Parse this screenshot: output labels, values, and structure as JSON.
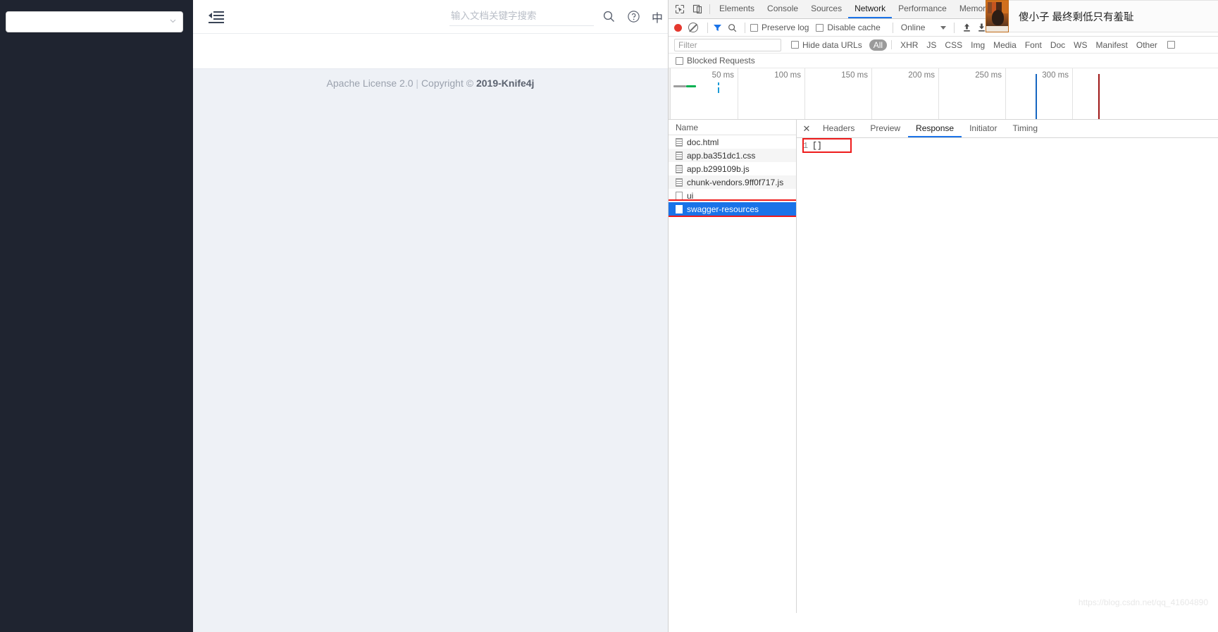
{
  "webpage": {
    "sidebar": {
      "select_value": "",
      "select_icon": "chevron-down-icon"
    },
    "header": {
      "menu_toggle_icon": "collapse-menu-icon",
      "search_placeholder": "输入文档关键字搜索",
      "search_value": "",
      "search_icon": "search-icon",
      "help_icon": "help-circle-icon",
      "language_label": "中"
    },
    "footer": {
      "license": "Apache License 2.0",
      "separator": "|",
      "copyright_prefix": "Copyright",
      "copyright_symbol": "©",
      "copyright_year_brand": "2019-Knife4j"
    }
  },
  "devtools": {
    "tool_icons": [
      {
        "name": "inspect-element-icon"
      },
      {
        "name": "device-toolbar-icon"
      }
    ],
    "panels": [
      {
        "label": "Elements",
        "active": false
      },
      {
        "label": "Console",
        "active": false
      },
      {
        "label": "Sources",
        "active": false
      },
      {
        "label": "Network",
        "active": true
      },
      {
        "label": "Performance",
        "active": false
      },
      {
        "label": "Memory",
        "active": false
      }
    ],
    "toast": {
      "text": "傻小子 最终剩低只有羞耻",
      "thumbnail_name": "video-thumbnail"
    },
    "toolbar": {
      "record_icon": "record-button-icon",
      "clear_icon": "clear-icon",
      "filter_icon": "filter-funnel-icon",
      "search_icon": "search-icon",
      "preserve_log_label": "Preserve log",
      "preserve_log_checked": false,
      "disable_cache_label": "Disable cache",
      "disable_cache_checked": false,
      "throttle_value": "Online",
      "throttle_caret_icon": "chevron-down-icon",
      "import_icon": "import-har-icon",
      "export_icon": "export-har-icon"
    },
    "filterbar": {
      "filter_placeholder": "Filter",
      "filter_value": "",
      "hide_data_urls_label": "Hide data URLs",
      "hide_data_urls_checked": false,
      "types": [
        {
          "label": "All",
          "active": true
        },
        {
          "label": "XHR",
          "active": false
        },
        {
          "label": "JS",
          "active": false
        },
        {
          "label": "CSS",
          "active": false
        },
        {
          "label": "Img",
          "active": false
        },
        {
          "label": "Media",
          "active": false
        },
        {
          "label": "Font",
          "active": false
        },
        {
          "label": "Doc",
          "active": false
        },
        {
          "label": "WS",
          "active": false
        },
        {
          "label": "Manifest",
          "active": false
        },
        {
          "label": "Other",
          "active": false
        }
      ],
      "trailing_checkbox_checked": false
    },
    "blocked_requests": {
      "label": "Blocked Requests",
      "checked": false
    },
    "overview": {
      "ticks": [
        "50 ms",
        "100 ms",
        "150 ms",
        "200 ms",
        "250 ms",
        "300 ms"
      ],
      "dom_content_loaded_color": "#1565c0",
      "load_event_color": "#9e1616",
      "waiting_color": "#9e9e9e",
      "download_color": "#00b050",
      "request_color": "#1a9ad6"
    },
    "request_list": {
      "column_header": "Name",
      "rows": [
        {
          "name": "doc.html",
          "icon": "document-icon",
          "selected": false
        },
        {
          "name": "app.ba351dc1.css",
          "icon": "document-icon",
          "selected": false
        },
        {
          "name": "app.b299109b.js",
          "icon": "document-icon",
          "selected": false
        },
        {
          "name": "chunk-vendors.9ff0f717.js",
          "icon": "document-icon",
          "selected": false
        },
        {
          "name": "ui",
          "icon": "blank-document-icon",
          "selected": false
        },
        {
          "name": "swagger-resources",
          "icon": "blank-document-icon",
          "selected": true
        }
      ]
    },
    "detail": {
      "close_icon": "close-icon",
      "tabs": [
        {
          "label": "Headers",
          "active": false
        },
        {
          "label": "Preview",
          "active": false
        },
        {
          "label": "Response",
          "active": true
        },
        {
          "label": "Initiator",
          "active": false
        },
        {
          "label": "Timing",
          "active": false
        }
      ],
      "response_lines": [
        {
          "number": "1",
          "code": "[]"
        }
      ]
    },
    "watermark": "https://blog.csdn.net/qq_41604890"
  }
}
